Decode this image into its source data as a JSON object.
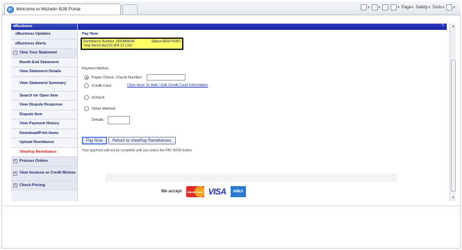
{
  "browser": {
    "tab_title": "Welcome to Michelin B2B Portal",
    "toolbar": [
      {
        "icon": "home-icon",
        "label": ""
      },
      {
        "icon": "rss-icon",
        "label": ""
      },
      {
        "icon": "mail-icon",
        "label": ""
      },
      {
        "icon": "print-icon",
        "label": ""
      },
      {
        "icon": "page-icon",
        "label": "Page"
      },
      {
        "icon": "safety-icon",
        "label": "Safety"
      },
      {
        "icon": "tools-icon",
        "label": "Tools"
      },
      {
        "icon": "help-icon",
        "label": ""
      }
    ]
  },
  "sidebar": {
    "header": "eBusiness",
    "items": [
      {
        "label": "eBusiness Updates"
      },
      {
        "label": "eBusiness Alerts"
      },
      {
        "label": "View Your Statement",
        "toggle": "−"
      },
      {
        "label": "Month End Statement"
      },
      {
        "label": "View Statement Details"
      },
      {
        "label": "View Statement Summary"
      },
      {
        "label": "Search for Open Item"
      },
      {
        "label": "View Dispute Response"
      },
      {
        "label": "Dispute Item"
      },
      {
        "label": "View Payment History"
      },
      {
        "label": "Download/Print Items"
      },
      {
        "label": "Upload Remittance"
      },
      {
        "label": "ViewPay Remittance"
      },
      {
        "label": "Process Orders",
        "toggle": "+"
      },
      {
        "label": "View Invoices or Credit Memos",
        "toggle": "+"
      },
      {
        "label": "Check Pricing",
        "toggle": "+"
      }
    ]
  },
  "main": {
    "title": "Pay Now",
    "remittance_label": "Remittance Number 1900884644",
    "status_label": "Status:REM-PEND",
    "total_label": "Total Remit Amt:52,604.21 USD",
    "payment_method_label": "Payment Method",
    "options": [
      {
        "label": "Paper Check: Check Number:",
        "selected": true
      },
      {
        "label": "Credit Card",
        "selected": false
      },
      {
        "label": "eCheck",
        "selected": false
      },
      {
        "label": "Other Method",
        "selected": false
      }
    ],
    "credit_link": "Click Here To Add / Edit Credit Card Information",
    "details_label": "Details :",
    "pay_button": "Pay Now",
    "return_button": "Return to ViewPay Remittances",
    "note": "Your payment will not be complete until you select the PAY NOW button",
    "accept_label": "We accept",
    "cards": {
      "mastercard": "MasterCard",
      "visa": "VISA",
      "amex": "AMEX"
    }
  },
  "colors": {
    "nav_header": "#1e2fa8",
    "highlight": "#ffff66",
    "link": "#1a2fb0",
    "active_nav": "#d02020"
  }
}
